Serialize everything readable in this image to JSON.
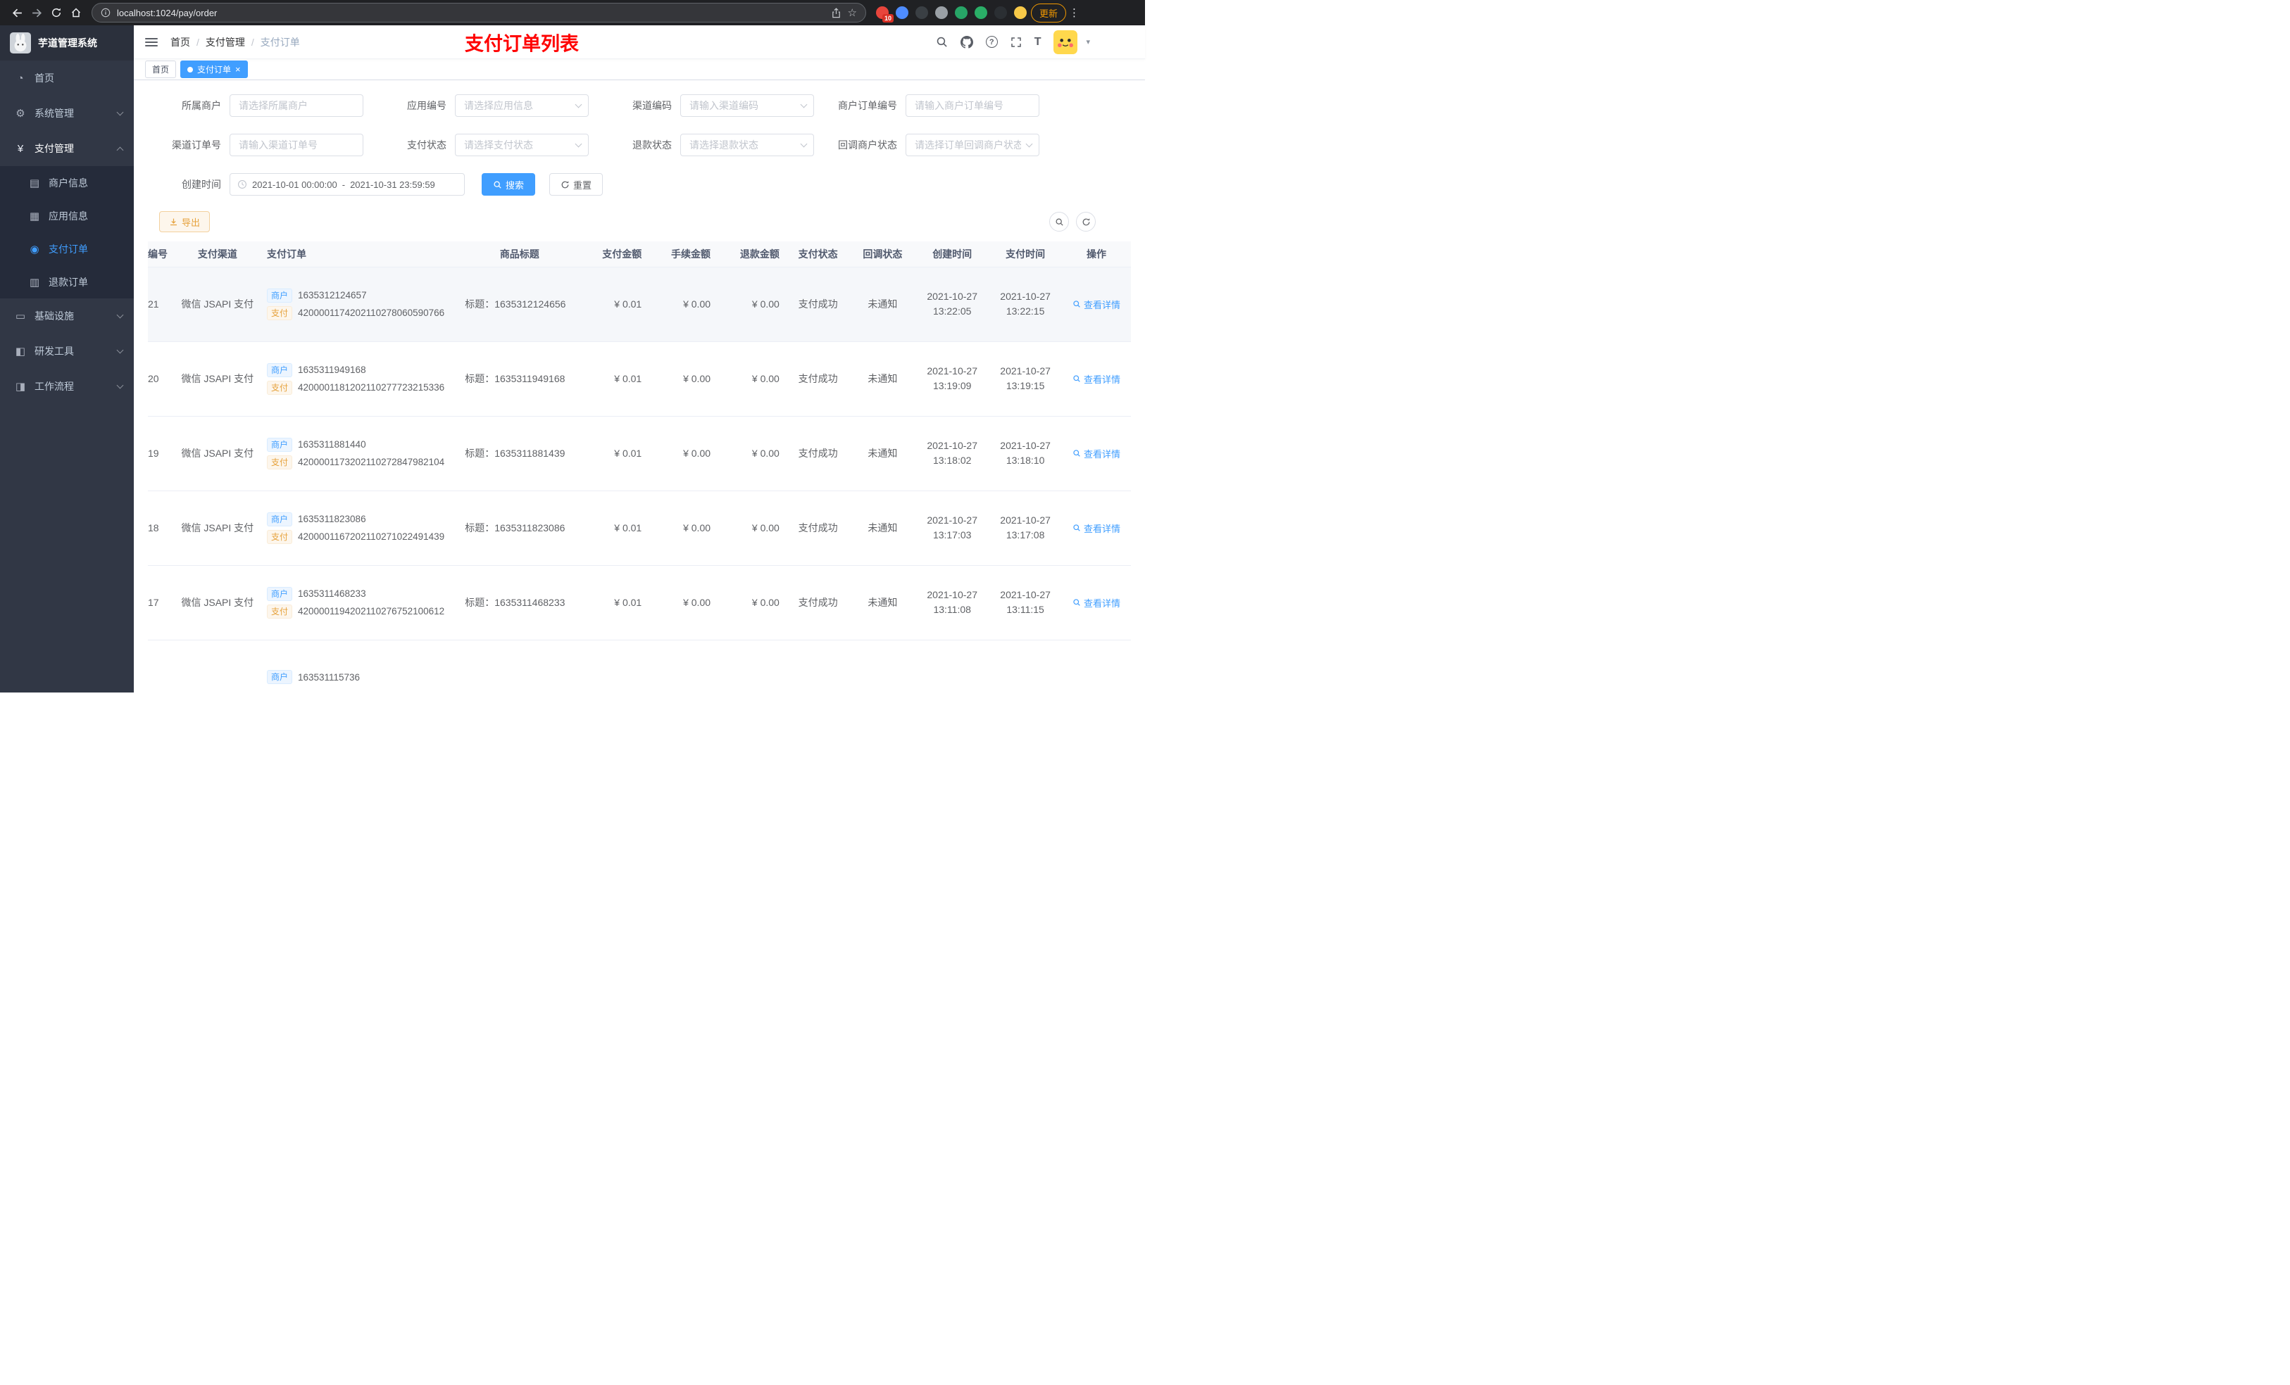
{
  "browser": {
    "url": "localhost:1024/pay/order",
    "update_label": "更新",
    "extensions": [
      {
        "name": "colorful-extension-icon",
        "color": "#e8453c",
        "badge": "10"
      },
      {
        "name": "blue-drop-extension-icon",
        "color": "#4e8cff"
      },
      {
        "name": "dark-globe-extension-icon",
        "color": "#3a3f44"
      },
      {
        "name": "gray-extension-icon",
        "color": "#9aa0a6"
      },
      {
        "name": "green-check-extension-icon",
        "color": "#27a567"
      },
      {
        "name": "green-chat-extension-icon",
        "color": "#2aae67"
      },
      {
        "name": "dark-pin-extension-icon",
        "color": "#2b2f33"
      },
      {
        "name": "emoji-face-extension-icon",
        "color": "#f7c948"
      }
    ]
  },
  "sidebar": {
    "logo_title": "芋道管理系统",
    "menu": [
      {
        "name": "home",
        "label": "首页",
        "icon": "dashboard-icon"
      },
      {
        "name": "system-management",
        "label": "系统管理",
        "icon": "gear-icon",
        "expandable": true
      },
      {
        "name": "payment-management",
        "label": "支付管理",
        "icon": "yen-icon",
        "expandable": true,
        "expanded": true,
        "children": [
          {
            "name": "merchant-info",
            "label": "商户信息",
            "icon": "credit-card-icon"
          },
          {
            "name": "app-info",
            "label": "应用信息",
            "icon": "grid-icon"
          },
          {
            "name": "payment-order",
            "label": "支付订单",
            "icon": "target-icon",
            "active": true
          },
          {
            "name": "refund-order",
            "label": "退款订单",
            "icon": "document-icon"
          }
        ]
      },
      {
        "name": "infrastructure",
        "label": "基础设施",
        "icon": "monitor-icon",
        "expandable": true
      },
      {
        "name": "dev-tools",
        "label": "研发工具",
        "icon": "tools-icon",
        "expandable": true
      },
      {
        "name": "workflow",
        "label": "工作流程",
        "icon": "workflow-icon",
        "expandable": true
      }
    ]
  },
  "header": {
    "breadcrumb": [
      "首页",
      "支付管理",
      "支付订单"
    ],
    "title": "支付订单列表"
  },
  "tabs": [
    {
      "name": "home",
      "label": "首页",
      "active": false,
      "closable": false
    },
    {
      "name": "pay-order",
      "label": "支付订单",
      "active": true,
      "closable": true
    }
  ],
  "filters": {
    "rows": [
      {
        "fields": [
          {
            "name": "merchant",
            "label": "所属商户",
            "placeholder": "请选择所属商户",
            "type": "input"
          },
          {
            "name": "app-no",
            "label": "应用编号",
            "placeholder": "请选择应用信息",
            "type": "select"
          },
          {
            "name": "channel-code",
            "label": "渠道编码",
            "placeholder": "请输入渠道编码",
            "type": "select"
          },
          {
            "name": "merchant-order-no",
            "label": "商户订单编号",
            "placeholder": "请输入商户订单编号",
            "type": "input"
          }
        ]
      },
      {
        "fields": [
          {
            "name": "channel-order-no",
            "label": "渠道订单号",
            "placeholder": "请输入渠道订单号",
            "type": "input"
          },
          {
            "name": "pay-status",
            "label": "支付状态",
            "placeholder": "请选择支付状态",
            "type": "select"
          },
          {
            "name": "refund-status",
            "label": "退款状态",
            "placeholder": "请选择退款状态",
            "type": "select"
          },
          {
            "name": "notify-status",
            "label": "回调商户状态",
            "placeholder": "请选择订单回调商户状态",
            "type": "select"
          }
        ]
      }
    ],
    "date_label": "创建时间",
    "date_start": "2021-10-01 00:00:00",
    "date_separator": "-",
    "date_end": "2021-10-31 23:59:59",
    "search_label": "搜索",
    "reset_label": "重置"
  },
  "toolbar": {
    "export_label": "导出"
  },
  "table": {
    "tag_merchant": "商户",
    "tag_pay": "支付",
    "headers": [
      "编号",
      "支付渠道",
      "支付订单",
      "商品标题",
      "支付金额",
      "手续金额",
      "退款金额",
      "支付状态",
      "回调状态",
      "创建时间",
      "支付时间",
      "操作"
    ],
    "rows": [
      {
        "id": "21",
        "channel": "微信 JSAPI 支付",
        "merchant_no": "1635312124657",
        "pay_no": "4200001174202110278060590766",
        "title": "标题：1635312124656",
        "amount": "¥ 0.01",
        "fee": "¥ 0.00",
        "refund": "¥ 0.00",
        "status": "支付成功",
        "notify": "未通知",
        "created_date": "2021-10-27",
        "created_time": "13:22:05",
        "paid_date": "2021-10-27",
        "paid_time": "13:22:15",
        "action": "查看详情",
        "highlighted": true
      },
      {
        "id": "20",
        "channel": "微信 JSAPI 支付",
        "merchant_no": "1635311949168",
        "pay_no": "4200001181202110277723215336",
        "title": "标题：1635311949168",
        "amount": "¥ 0.01",
        "fee": "¥ 0.00",
        "refund": "¥ 0.00",
        "status": "支付成功",
        "notify": "未通知",
        "created_date": "2021-10-27",
        "created_time": "13:19:09",
        "paid_date": "2021-10-27",
        "paid_time": "13:19:15",
        "action": "查看详情"
      },
      {
        "id": "19",
        "channel": "微信 JSAPI 支付",
        "merchant_no": "1635311881440",
        "pay_no": "4200001173202110272847982104",
        "title": "标题：1635311881439",
        "amount": "¥ 0.01",
        "fee": "¥ 0.00",
        "refund": "¥ 0.00",
        "status": "支付成功",
        "notify": "未通知",
        "created_date": "2021-10-27",
        "created_time": "13:18:02",
        "paid_date": "2021-10-27",
        "paid_time": "13:18:10",
        "action": "查看详情"
      },
      {
        "id": "18",
        "channel": "微信 JSAPI 支付",
        "merchant_no": "1635311823086",
        "pay_no": "4200001167202110271022491439",
        "title": "标题：1635311823086",
        "amount": "¥ 0.01",
        "fee": "¥ 0.00",
        "refund": "¥ 0.00",
        "status": "支付成功",
        "notify": "未通知",
        "created_date": "2021-10-27",
        "created_time": "13:17:03",
        "paid_date": "2021-10-27",
        "paid_time": "13:17:08",
        "action": "查看详情"
      },
      {
        "id": "17",
        "channel": "微信 JSAPI 支付",
        "merchant_no": "1635311468233",
        "pay_no": "4200001194202110276752100612",
        "title": "标题：1635311468233",
        "amount": "¥ 0.01",
        "fee": "¥ 0.00",
        "refund": "¥ 0.00",
        "status": "支付成功",
        "notify": "未通知",
        "created_date": "2021-10-27",
        "created_time": "13:11:08",
        "paid_date": "2021-10-27",
        "paid_time": "13:11:15",
        "action": "查看详情"
      },
      {
        "id": "",
        "channel": "",
        "merchant_no": "163531115736",
        "pay_no": "",
        "title": "",
        "amount": "",
        "fee": "",
        "refund": "",
        "status": "",
        "notify": "",
        "created_date": "",
        "created_time": "",
        "paid_date": "",
        "paid_time": "",
        "action": ""
      }
    ]
  }
}
